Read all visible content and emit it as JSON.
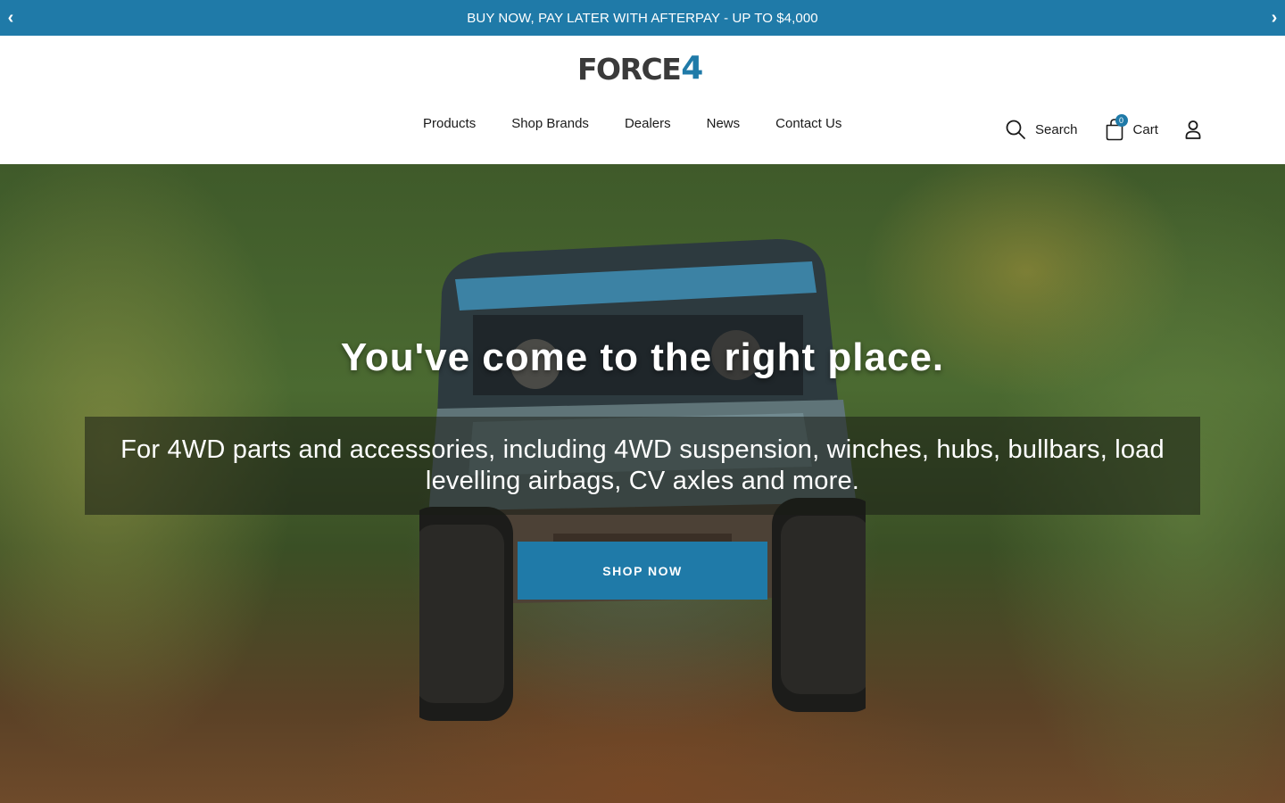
{
  "announcement": {
    "text": "BUY NOW, PAY LATER WITH AFTERPAY - UP TO $4,000",
    "prev_icon": "‹",
    "next_icon": "›"
  },
  "header": {
    "logo": {
      "part1": "FORCE",
      "part2": "4"
    },
    "nav": [
      "Products",
      "Shop Brands",
      "Dealers",
      "News",
      "Contact Us"
    ],
    "search_label": "Search",
    "cart_label": "Cart",
    "cart_count": "0",
    "icons": {
      "search": "search-icon",
      "cart": "bag-icon",
      "account": "user-icon"
    }
  },
  "hero": {
    "title": "You've come to the right place.",
    "subtitle": "For 4WD parts and accessories, including 4WD suspension, winches, hubs, bullbars, load levelling airbags, CV axles and more.",
    "cta": "SHOP NOW"
  },
  "colors": {
    "accent": "#1f7aa8"
  }
}
